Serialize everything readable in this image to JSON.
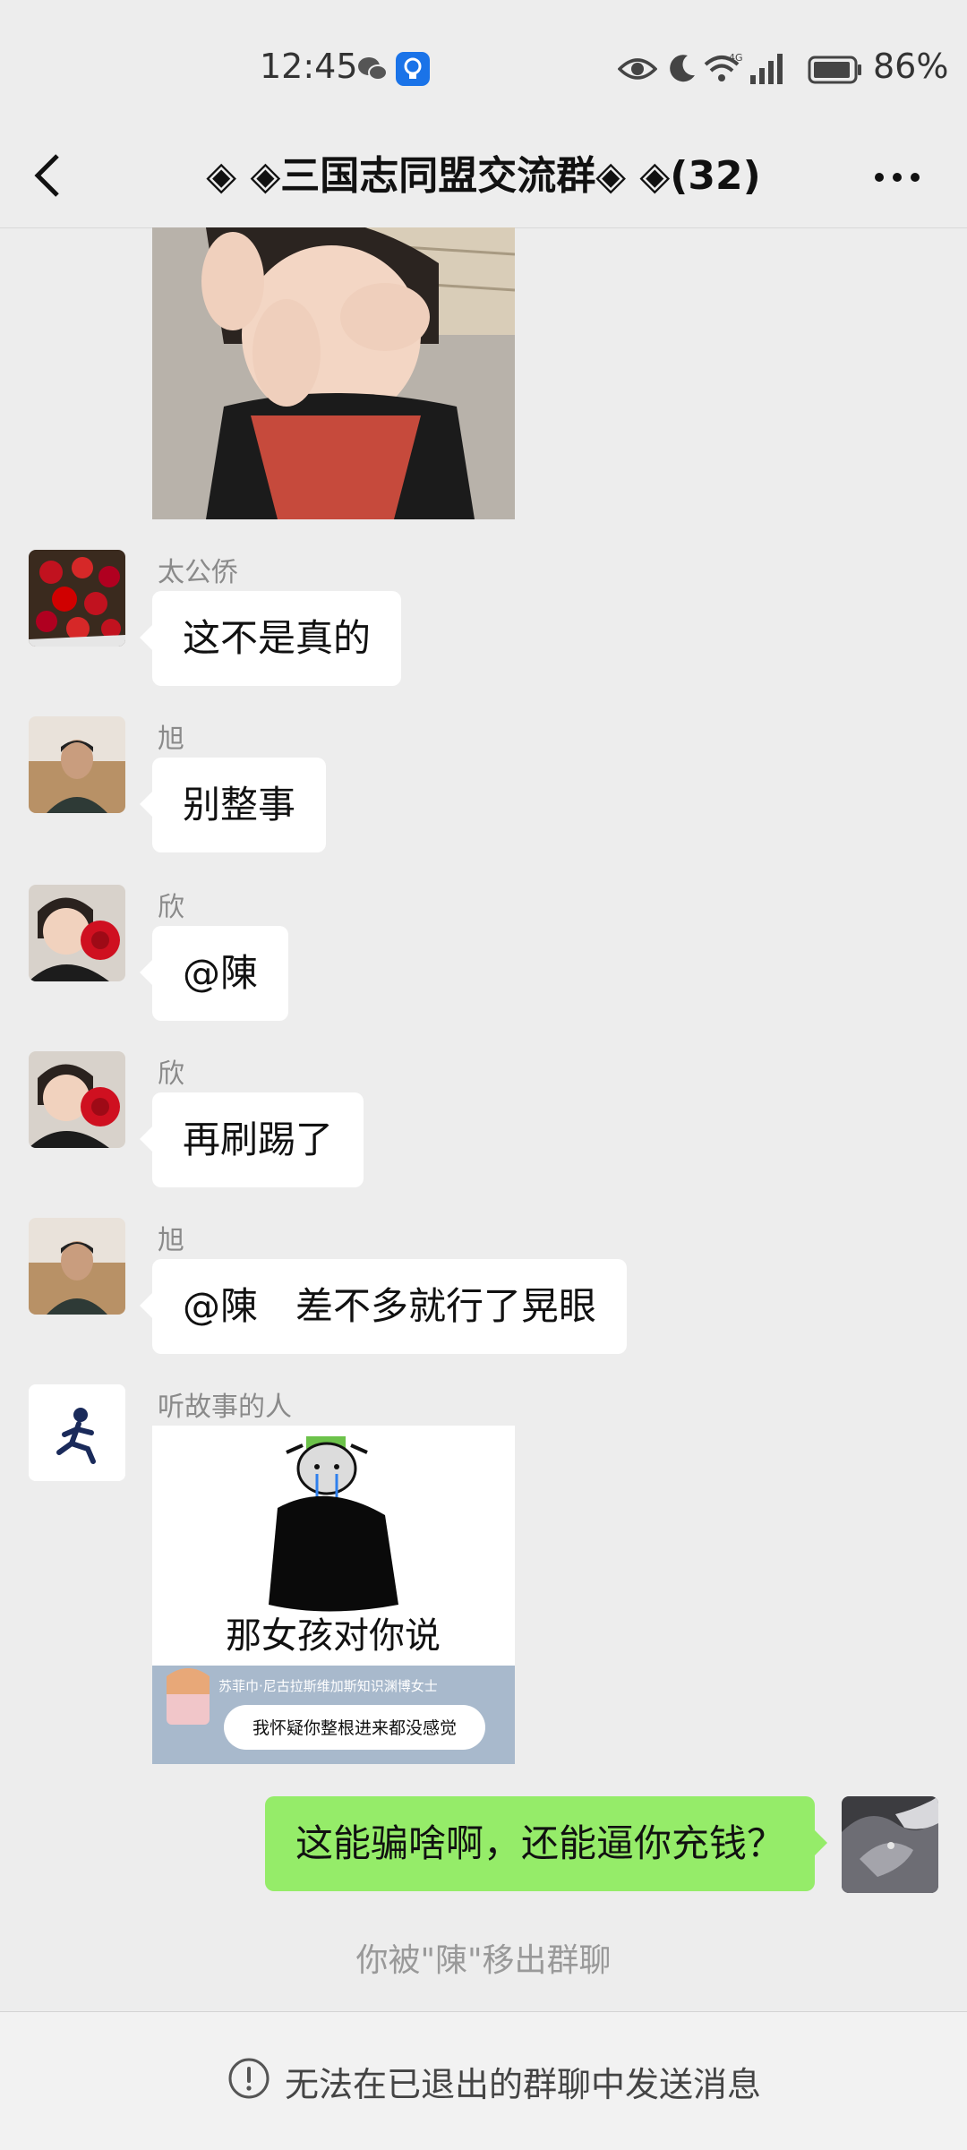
{
  "status_bar": {
    "time": "12:45",
    "battery": "86%",
    "network": "4G",
    "icons": [
      "wechat-icon",
      "notification-bulb-icon",
      "eye-icon",
      "moon-icon",
      "wifi-icon",
      "signal-icon",
      "battery-icon"
    ]
  },
  "header": {
    "back_icon": "chevron-left-icon",
    "title": "◈ ◈三国志同盟交流群◈ ◈(32)",
    "more_icon": "ellipsis-icon"
  },
  "messages": [
    {
      "type": "image",
      "sender": "",
      "image_desc": "child-photo-sticker"
    },
    {
      "type": "text",
      "sender": "太公侨",
      "text": "这不是真的"
    },
    {
      "type": "text",
      "sender": "旭",
      "text": "别整事"
    },
    {
      "type": "text",
      "sender": "欣",
      "text": "@陳"
    },
    {
      "type": "text",
      "sender": "欣",
      "text": "再刷踢了"
    },
    {
      "type": "text",
      "sender": "旭",
      "text": "@陳　差不多就行了晃眼"
    },
    {
      "type": "image",
      "sender": "听故事的人",
      "sticker_caption": "那女孩对你说",
      "sticker_subcaption": "苏菲巾·尼古拉斯维加斯知识渊博女士",
      "sticker_quote": "我怀疑你整根进来都没感觉"
    },
    {
      "type": "text",
      "sender": "me",
      "mine": true,
      "text": "这能骗啥啊，还能逼你充钱？"
    }
  ],
  "system_notice": "你被\"陳\"移出群聊",
  "bottom_notice": "无法在已退出的群聊中发送消息",
  "colors": {
    "background": "#ededed",
    "my_bubble": "#95ec69",
    "their_bubble": "#ffffff"
  }
}
